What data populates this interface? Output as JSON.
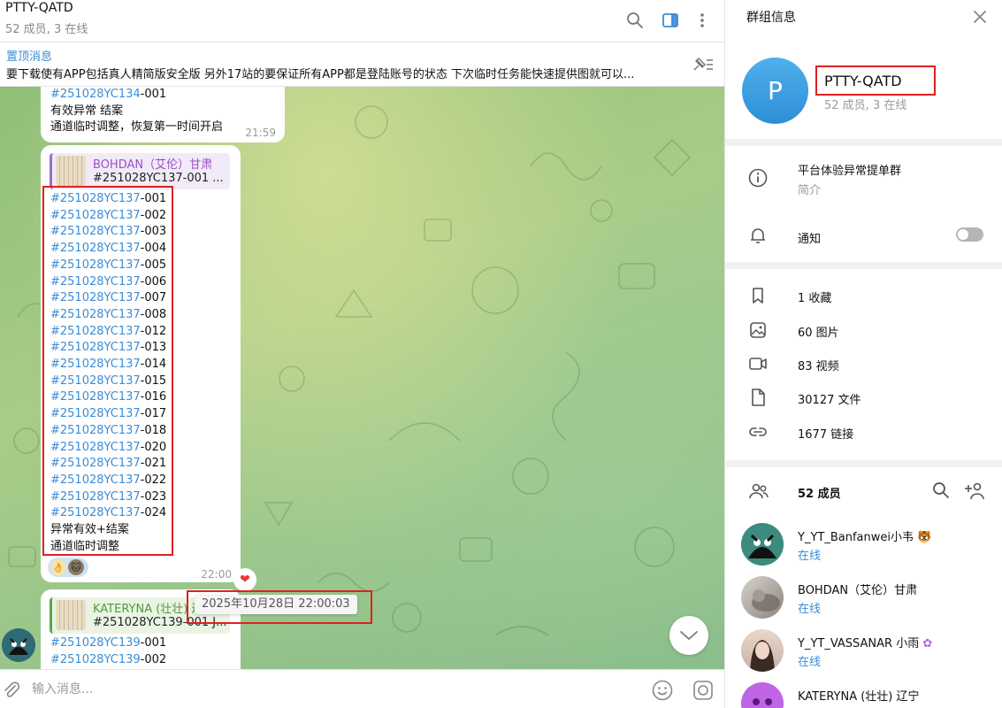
{
  "chat": {
    "title": "PTTY-QATD",
    "subtitle": "52 成员, 3 在线",
    "pinned_title": "置顶消息",
    "pinned_text": "要下载使有APP包括真人精简版安全版 另外17站的要保证所有APP都是登陆账号的状态  下次临时任务能快速提供图就可以...",
    "message1": {
      "lines": [
        {
          "tag": "#251028YC134",
          "rest": "-001"
        },
        {
          "tag": "",
          "rest": "有效异常 结案"
        },
        {
          "tag": "",
          "rest": "通道临时调整，恢复第一时间开启"
        }
      ],
      "time": "21:59"
    },
    "message2": {
      "reply_name": "BOHDAN（艾伦）甘肃",
      "reply_text": "#251028YC137-001  ...",
      "lines": [
        {
          "tag": "#251028YC137",
          "rest": "-001"
        },
        {
          "tag": "#251028YC137",
          "rest": "-002"
        },
        {
          "tag": "#251028YC137",
          "rest": "-003"
        },
        {
          "tag": "#251028YC137",
          "rest": "-004"
        },
        {
          "tag": "#251028YC137",
          "rest": "-005"
        },
        {
          "tag": "#251028YC137",
          "rest": "-006"
        },
        {
          "tag": "#251028YC137",
          "rest": "-007"
        },
        {
          "tag": "#251028YC137",
          "rest": "-008"
        },
        {
          "tag": "#251028YC137",
          "rest": "-012"
        },
        {
          "tag": "#251028YC137",
          "rest": "-013"
        },
        {
          "tag": "#251028YC137",
          "rest": "-014"
        },
        {
          "tag": "#251028YC137",
          "rest": "-015"
        },
        {
          "tag": "#251028YC137",
          "rest": "-016"
        },
        {
          "tag": "#251028YC137",
          "rest": "-017"
        },
        {
          "tag": "#251028YC137",
          "rest": "-018"
        },
        {
          "tag": "#251028YC137",
          "rest": "-020"
        },
        {
          "tag": "#251028YC137",
          "rest": "-021"
        },
        {
          "tag": "#251028YC137",
          "rest": "-022"
        },
        {
          "tag": "#251028YC137",
          "rest": "-023"
        },
        {
          "tag": "#251028YC137",
          "rest": "-024"
        },
        {
          "tag": "",
          "rest": "异常有效+结案"
        },
        {
          "tag": "",
          "rest": "通道临时调整"
        }
      ],
      "reactions": [
        "👌",
        "🐱"
      ],
      "time": "22:00",
      "heart": "❤"
    },
    "message3": {
      "reply_name": "KATERYNA (壮壮) 辽",
      "reply_text": "#251028YC139-001 J...",
      "lines": [
        {
          "tag": "#251028YC139",
          "rest": "-001"
        },
        {
          "tag": "#251028YC139",
          "rest": "-002"
        }
      ]
    },
    "tooltip": "2025年10月28日 22:00:03",
    "composer_placeholder": "输入消息..."
  },
  "info": {
    "title": "群组信息",
    "avatar_letter": "P",
    "group_name": "PTTY-QATD",
    "group_meta": "52 成员, 3 在线",
    "description": "平台体验异常提单群",
    "description_label": "简介",
    "notifications_label": "通知",
    "notifications_on": false,
    "media": [
      {
        "icon": "bookmark-icon",
        "label": "1 收藏"
      },
      {
        "icon": "image-icon",
        "label": "60 图片"
      },
      {
        "icon": "video-icon",
        "label": "83 视频"
      },
      {
        "icon": "file-icon",
        "label": "30127 文件"
      },
      {
        "icon": "link-icon",
        "label": "1677 链接"
      }
    ],
    "members_count": "52 成员",
    "members": [
      {
        "name": "Y_YT_Banfanwei小韦 🐯",
        "status": "在线"
      },
      {
        "name": "BOHDAN（艾伦）甘肃",
        "status": "在线"
      },
      {
        "name": "Y_YT_VASSANAR 小雨",
        "status": "在线"
      },
      {
        "name": "KATERYNA (壮壮) 辽宁",
        "status": ""
      }
    ]
  },
  "colors": {
    "accent": "#3a8cd7",
    "highlight_box": "#e02020",
    "chat_bg": "#a9cc88"
  }
}
